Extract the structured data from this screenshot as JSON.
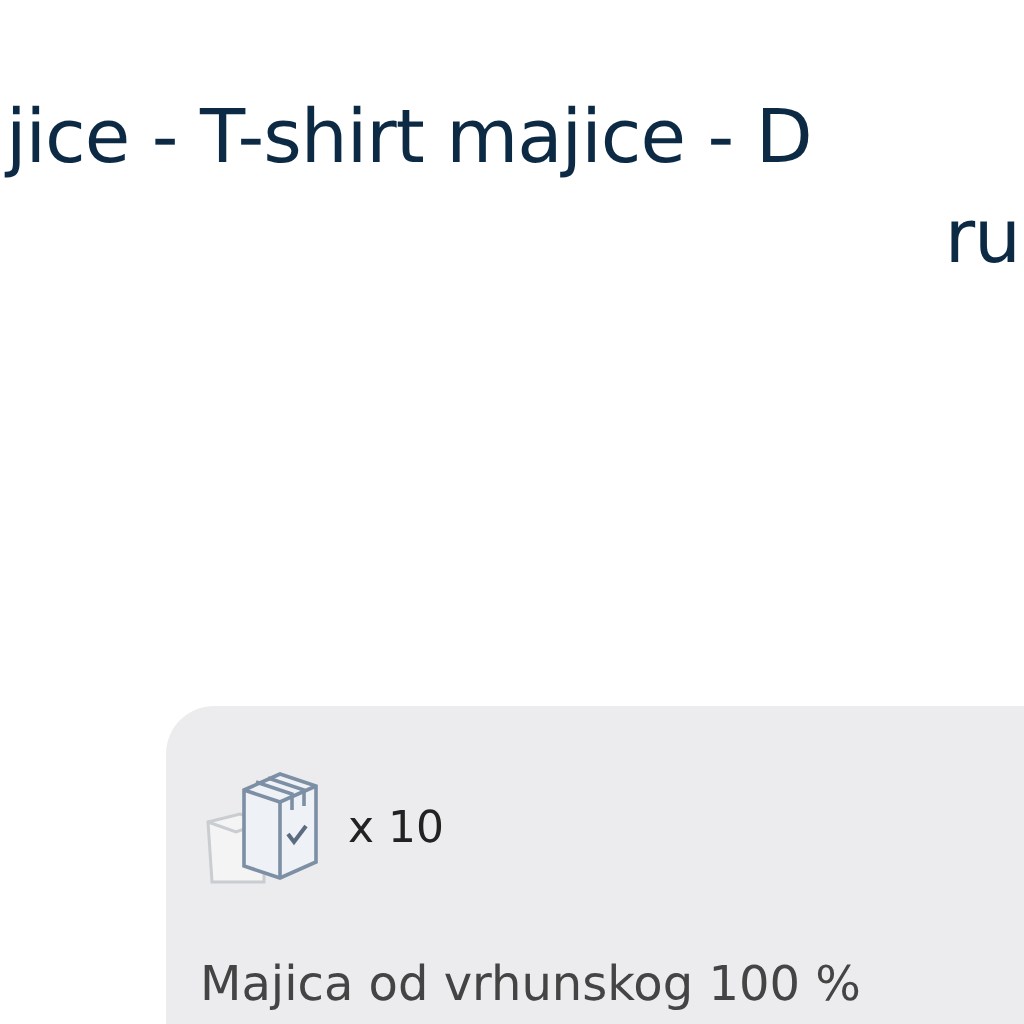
{
  "title": {
    "lines": [
      "jice - T-shirt majice - D",
      "ru"
    ]
  },
  "card": {
    "quantity": "x 10",
    "description": "Majica od vrhunskog 100 %"
  }
}
